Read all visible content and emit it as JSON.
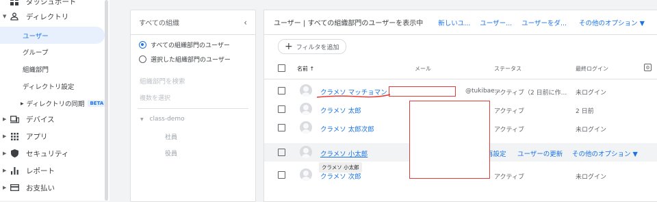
{
  "sidebar": {
    "top_item": "ダッシュボード",
    "directory": "ディレクトリ",
    "sub_items": [
      "ユーザー",
      "グループ",
      "組織部門",
      "ディレクトリ設定"
    ],
    "sync": "ディレクトリの同期",
    "beta": "BETA",
    "items": [
      {
        "label": "デバイス",
        "icon": "device-icon"
      },
      {
        "label": "アプリ",
        "icon": "apps-grid-icon"
      },
      {
        "label": "セキュリティ",
        "icon": "shield-icon"
      },
      {
        "label": "レポート",
        "icon": "bar-chart-icon"
      },
      {
        "label": "お支払い",
        "icon": "billing-card-icon"
      }
    ]
  },
  "org_panel": {
    "title": "すべての組織",
    "options": [
      "すべての組織部門のユーザー",
      "選択した組織部門のユーザー"
    ],
    "search_placeholder": "組織部門を検索",
    "multi_select": "複数を選択",
    "tree": {
      "root": "class-demo",
      "children": [
        "社員",
        "役員"
      ]
    }
  },
  "main": {
    "title": "ユーザー | すべての組織部門のユーザーを表示中",
    "actions": [
      "新しいユ...",
      "ユーザー...",
      "ユーザーをダ...",
      "その他のオプション ▼"
    ],
    "filter": "フィルタを追加",
    "columns": {
      "name": "名前 ↑",
      "email": "メール",
      "status": "ステータス",
      "last_login": "最終ログイン"
    },
    "rows": [
      {
        "name": "クラメソ マッチョマン",
        "email": "@tukibae...",
        "status": "アクティブ（2 日前に作...",
        "last_login": "未ログイン"
      },
      {
        "name": "クラメソ 太郎",
        "email": "",
        "status": "アクティブ",
        "last_login": "2 日前"
      },
      {
        "name": "クラメソ 太郎次郎",
        "email": "",
        "status": "アクティブ",
        "last_login": "未ログイン"
      },
      {
        "name": "クラメソ 小太郎",
        "email": "",
        "status": "",
        "last_login": "",
        "hover_actions": [
          "再設定",
          "ユーザーの更新",
          "その他のオプション ▼"
        ]
      },
      {
        "name": "クラメソ 次郎",
        "email": "",
        "status": "アクティブ",
        "last_login": "未ログイン"
      }
    ],
    "tooltip": "クラメソ 小太郎"
  }
}
